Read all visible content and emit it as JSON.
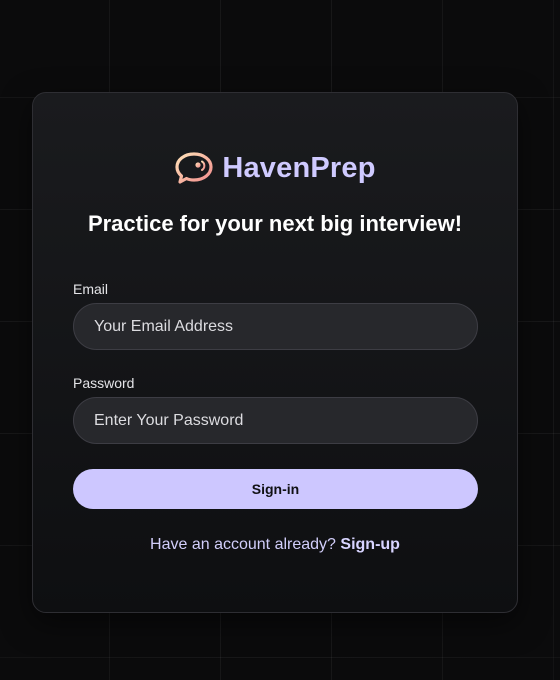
{
  "brand": {
    "name": "HavenPrep",
    "logo_icon": "speech-bubble-icon"
  },
  "headline": "Practice for your next big interview!",
  "form": {
    "email": {
      "label": "Email",
      "placeholder": "Your Email Address",
      "value": ""
    },
    "password": {
      "label": "Password",
      "placeholder": "Enter Your Password",
      "value": ""
    },
    "submit_label": "Sign-in"
  },
  "footer": {
    "prompt": "Have an account already?",
    "link_label": "Sign-up"
  },
  "colors": {
    "accent": "#cdc7ff",
    "brand_text": "#cfcaff",
    "logo_gradient_start": "#ffd7a8",
    "logo_gradient_end": "#f08a8a",
    "background": "#0b0b0c"
  }
}
